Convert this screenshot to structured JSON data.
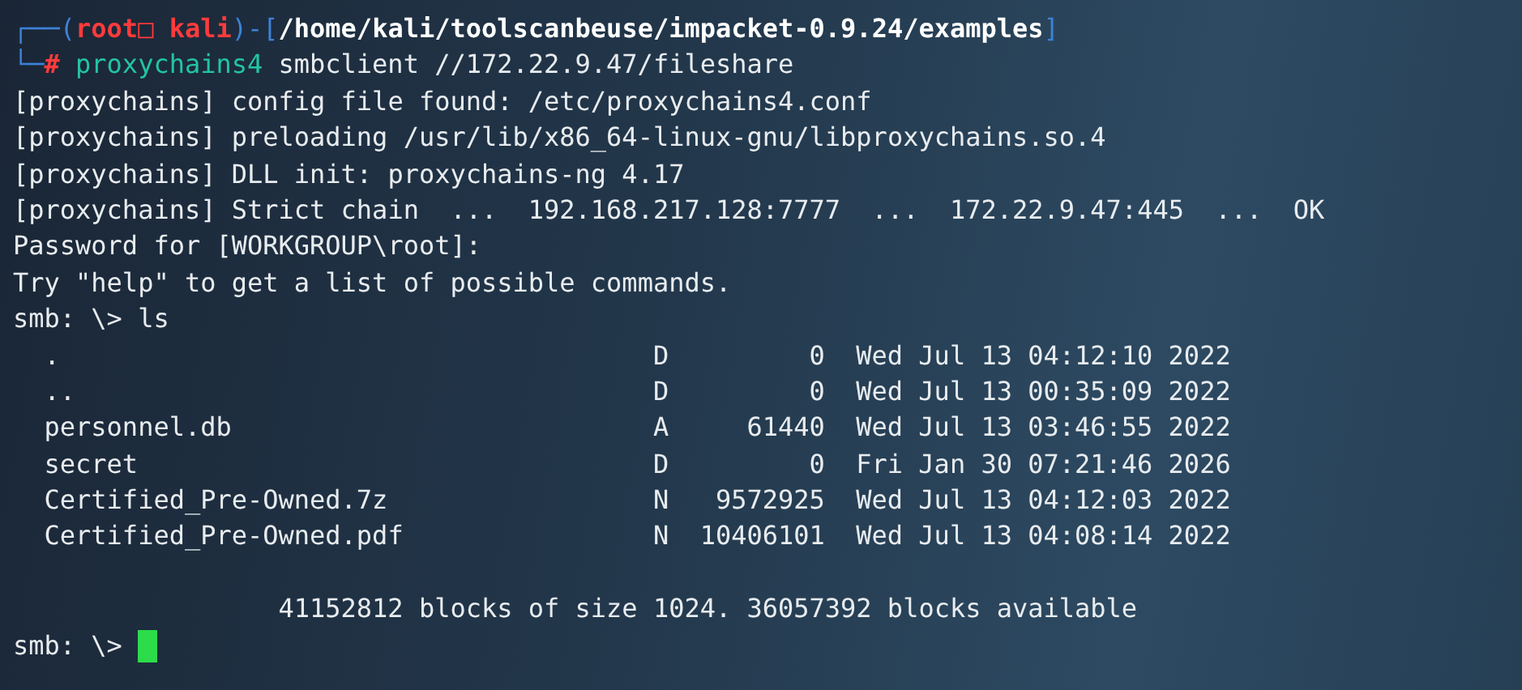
{
  "prompt": {
    "frame_top": "┌──(",
    "user_host": "root□ kali",
    "frame_mid": ")-[",
    "path": "/home/kali/toolscanbeuse/impacket-0.9.24/examples",
    "frame_end": "]",
    "frame_bottom": "└─",
    "symbol": "#",
    "program": "proxychains4",
    "args": "smbclient //172.22.9.47/fileshare"
  },
  "output_lines": [
    "[proxychains] config file found: /etc/proxychains4.conf",
    "[proxychains] preloading /usr/lib/x86_64-linux-gnu/libproxychains.so.4",
    "[proxychains] DLL init: proxychains-ng 4.17",
    "[proxychains] Strict chain  ...  192.168.217.128:7777  ...  172.22.9.47:445  ...  OK",
    "Password for [WORKGROUP\\root]:",
    "Try \"help\" to get a list of possible commands."
  ],
  "smb_command": {
    "prompt": "smb: \\>",
    "command": "ls"
  },
  "listing": [
    {
      "name": ".",
      "attr": "D",
      "size": "0",
      "date": "Wed Jul 13 04:12:10 2022"
    },
    {
      "name": "..",
      "attr": "D",
      "size": "0",
      "date": "Wed Jul 13 00:35:09 2022"
    },
    {
      "name": "personnel.db",
      "attr": "A",
      "size": "61440",
      "date": "Wed Jul 13 03:46:55 2022"
    },
    {
      "name": "secret",
      "attr": "D",
      "size": "0",
      "date": "Fri Jan 30 07:21:46 2026"
    },
    {
      "name": "Certified_Pre-Owned.7z",
      "attr": "N",
      "size": "9572925",
      "date": "Wed Jul 13 04:12:03 2022"
    },
    {
      "name": "Certified_Pre-Owned.pdf",
      "attr": "N",
      "size": "10406101",
      "date": "Wed Jul 13 04:08:14 2022"
    }
  ],
  "summary": "41152812 blocks of size 1024. 36057392 blocks available",
  "final_prompt": {
    "prompt": "smb: \\>",
    "cursor": true
  }
}
